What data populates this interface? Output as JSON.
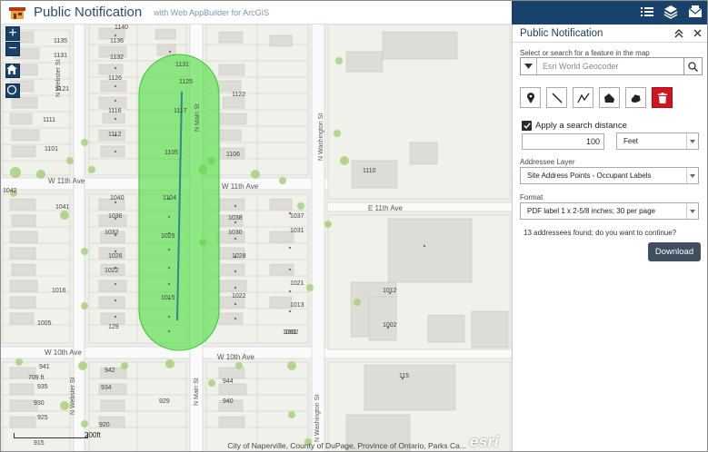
{
  "header": {
    "title": "Public Notification",
    "subtitle": "with Web AppBuilder for ArcGIS"
  },
  "toolbar": {
    "icons": [
      "list-icon",
      "layers-icon",
      "envelope-icon"
    ]
  },
  "panel": {
    "title": "Public Notification",
    "search_label": "Select or search for a feature in the map",
    "search_placeholder": "Esri World Geocoder",
    "draw_tools": [
      "point-tool",
      "line-tool",
      "polyline-tool",
      "polygon-tool",
      "freehand-polygon-tool",
      "delete-tool"
    ],
    "search_distance_label": "Apply a search distance",
    "search_distance_checked": true,
    "distance_value": "100",
    "distance_unit": "Feet",
    "addressee_label": "Addressee Layer",
    "addressee_value": "Site Address Points - Occupant Labels",
    "format_label": "Format",
    "format_value": "PDF label 1 x 2-5/8 inches; 30 per page",
    "result_text": "13 addressees found; do you want to continue?",
    "download_label": "Download"
  },
  "map": {
    "zoom_in": "+",
    "zoom_out": "−",
    "scale_label": "200ft",
    "attribution": "City of Naperville, County of DuPage, Province of Ontario, Parks Ca...",
    "esri_logo": "esri",
    "streets": {
      "w_11th_ave": "W 11th Ave",
      "e_11th_ave": "E 11th Ave",
      "w_10th_ave_left": "W 10th Ave",
      "w_10th_ave_right": "W 10th Ave",
      "n_webster_st": "N Webster St",
      "n_main_st": "N Main St",
      "n_washington_st": "N Washington St"
    },
    "addresses": [
      "1140",
      "1135",
      "1136",
      "1131",
      "1132",
      "1131",
      "1125",
      "1126",
      "1121",
      "1122",
      "1117",
      "1116",
      "1112",
      "1111",
      "1105",
      "1106",
      "1110",
      "1101",
      "1042",
      "1041",
      "1040",
      "1036",
      "1032",
      "1026",
      "1022",
      "1016",
      "1005",
      "129",
      "1104",
      "1037",
      "1038",
      "1031",
      "1030",
      "1025",
      "1028",
      "1022",
      "1021",
      "1015",
      "1013",
      "1002",
      "1012",
      "1002",
      "1001",
      "941",
      "942",
      "935",
      "934",
      "930",
      "929",
      "925",
      "920",
      "915",
      "944",
      "940",
      "115",
      "117",
      "1131",
      "1132",
      "1116",
      "1121",
      "1125",
      "1111",
      "1112",
      "709 ft"
    ]
  },
  "colors": {
    "primary": "#18426c",
    "buffer_fill": "#4cdd3e",
    "delete_red": "#d2141e",
    "download_bg": "#3f4f5f"
  }
}
